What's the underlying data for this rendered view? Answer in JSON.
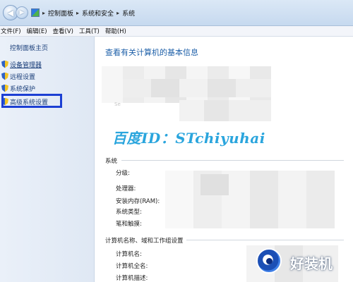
{
  "breadcrumb": {
    "items": [
      "控制面板",
      "系统和安全",
      "系统"
    ]
  },
  "menubar": {
    "items": [
      "文件(F)",
      "编辑(E)",
      "查看(V)",
      "工具(T)",
      "帮助(H)"
    ]
  },
  "sidebar": {
    "home": "控制面板主页",
    "tasks": [
      {
        "label": "设备管理器",
        "icon": "shield-icon"
      },
      {
        "label": "远程设置",
        "icon": "shield-icon"
      },
      {
        "label": "系统保护",
        "icon": "shield-icon"
      },
      {
        "label": "高级系统设置",
        "icon": "shield-icon"
      }
    ]
  },
  "main": {
    "title": "查看有关计算机的基本信息",
    "faint_text": "Se",
    "watermark": "百度ID：STchiyuhai",
    "system_section": {
      "title": "系统",
      "fields": [
        "分级:",
        "处理器:",
        "安装内存(RAM):",
        "系统类型:",
        "笔和触摸:"
      ]
    },
    "computer_section": {
      "title": "计算机名称、域和工作组设置",
      "fields": [
        "计算机名:",
        "计算机全名:",
        "计算机描述:"
      ]
    }
  },
  "badge": {
    "text": "好装机"
  },
  "colors": {
    "link": "#1b3f7a",
    "title": "#1d5fa8",
    "watermark": "#2aa5dd",
    "highlight_box": "#1c3fd3"
  }
}
